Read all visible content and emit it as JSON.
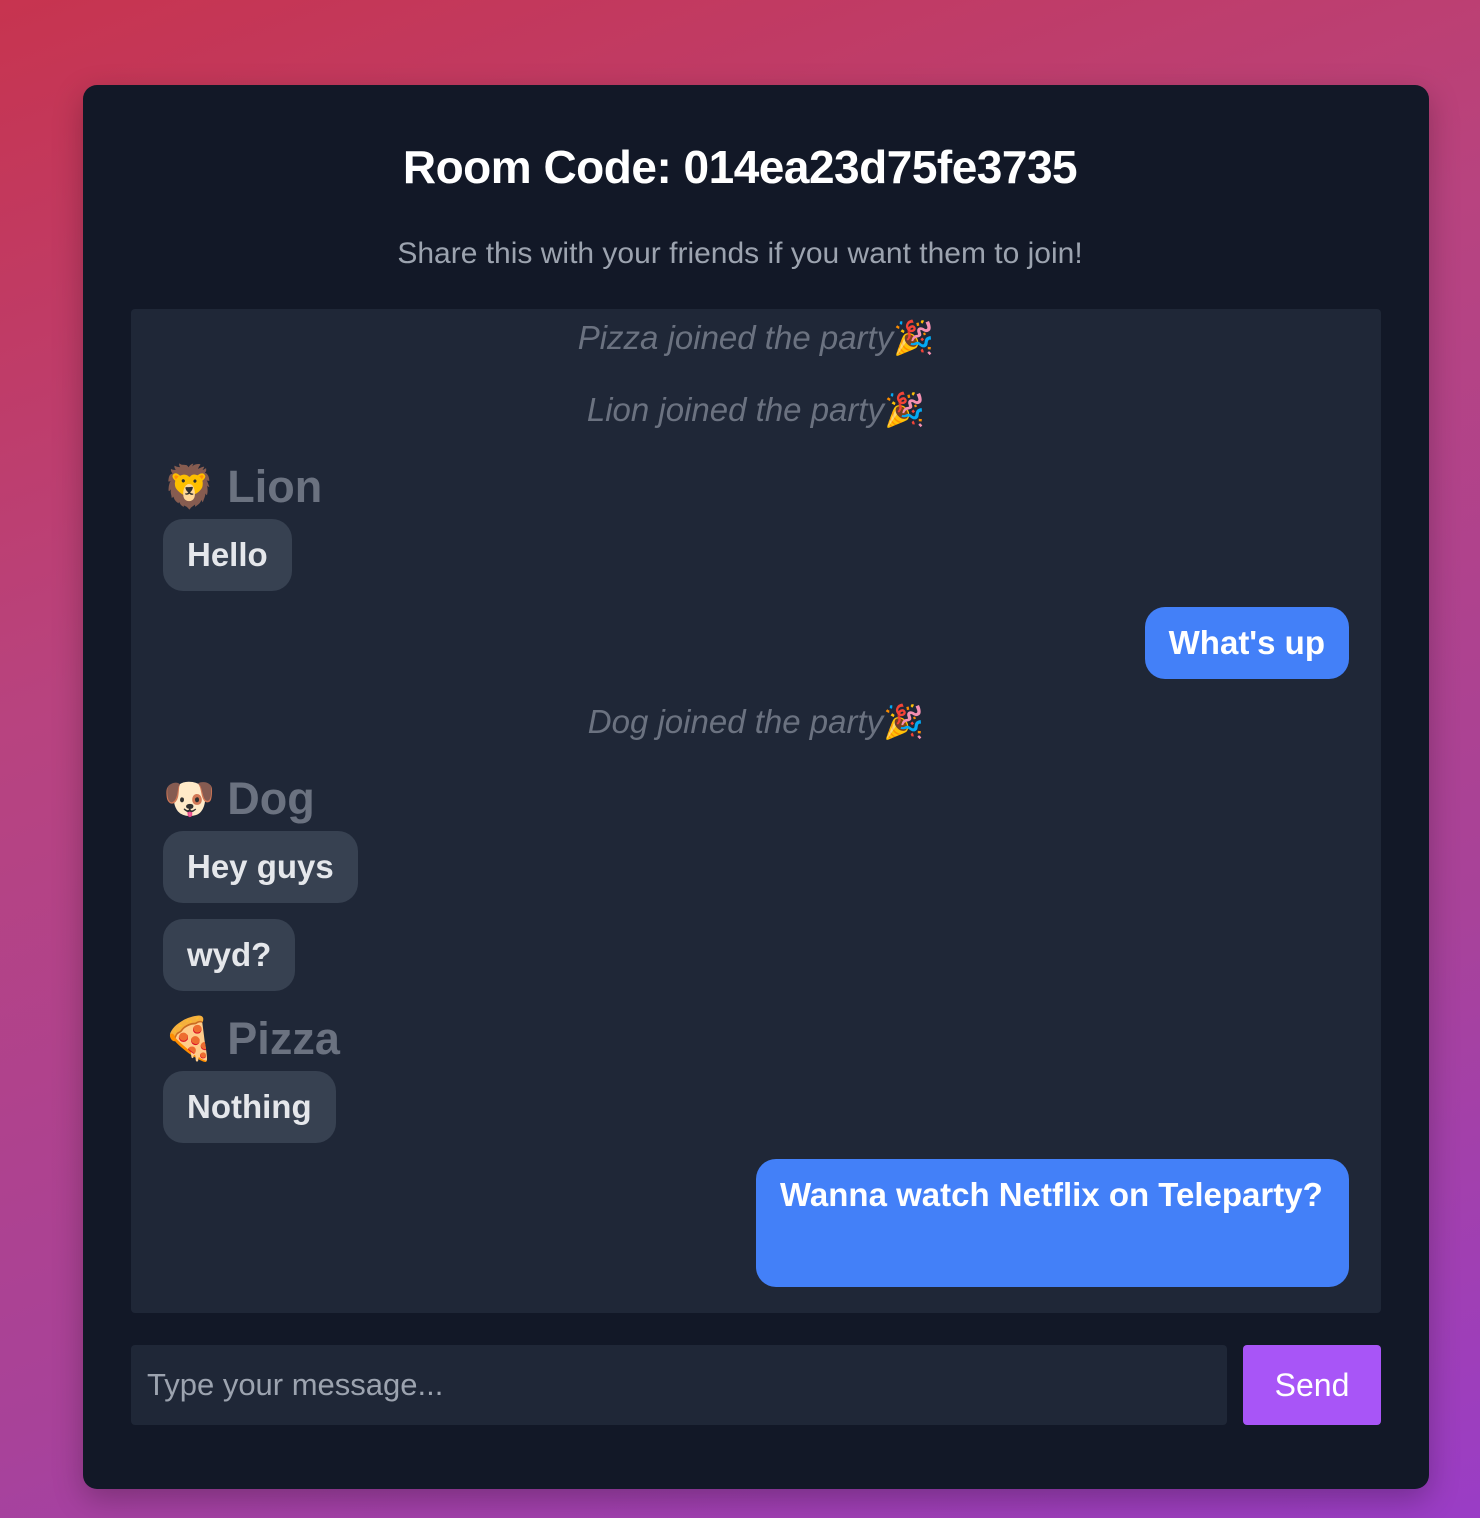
{
  "room": {
    "title": "Room Code: 014ea23d75fe3735",
    "subtitle": "Share this with your friends if you want them to join!"
  },
  "messages": [
    {
      "type": "system",
      "text": "Pizza joined the party",
      "emoji": "🎉"
    },
    {
      "type": "system",
      "text": "Lion joined the party",
      "emoji": "🎉"
    },
    {
      "type": "sender",
      "avatar": "🦁",
      "name": "Lion"
    },
    {
      "type": "message",
      "text": "Hello",
      "own": false
    },
    {
      "type": "message",
      "text": "What's up",
      "own": true
    },
    {
      "type": "system",
      "text": "Dog joined the party",
      "emoji": "🎉"
    },
    {
      "type": "sender",
      "avatar": "🐶",
      "name": "Dog"
    },
    {
      "type": "message",
      "text": "Hey guys",
      "own": false
    },
    {
      "type": "message",
      "text": "wyd?",
      "own": false
    },
    {
      "type": "sender",
      "avatar": "🍕",
      "name": "Pizza"
    },
    {
      "type": "message",
      "text": "Nothing",
      "own": false
    },
    {
      "type": "message",
      "text": "Wanna watch Netflix on Teleparty?",
      "own": true
    }
  ],
  "composer": {
    "placeholder": "Type your message...",
    "value": "",
    "send_label": "Send"
  },
  "colors": {
    "card_background": "#121827",
    "chat_background": "#1f2737",
    "own_bubble": "#4380f8",
    "other_bubble": "#374151",
    "send_button": "#a855f7"
  }
}
